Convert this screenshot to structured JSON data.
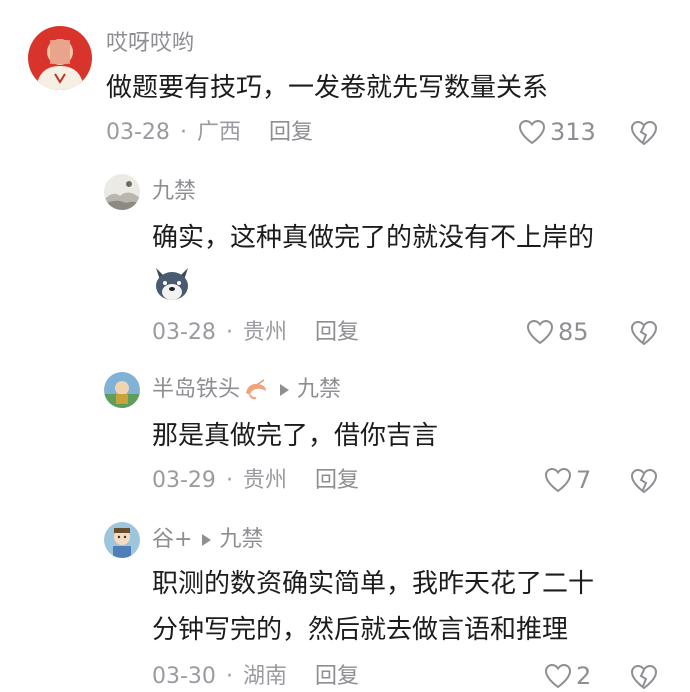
{
  "comments": [
    {
      "author": "哎呀哎哟",
      "text": [
        "做题要有技巧，一发卷就先写数量关系"
      ],
      "date": "03-28",
      "region": "广西",
      "reply_label": "回复",
      "likes": "313",
      "avatar_icon": "person-avatar"
    },
    {
      "author": "九禁",
      "text": [
        "确实，这种真做完了的就没有不上岸的"
      ],
      "date": "03-28",
      "region": "贵州",
      "reply_label": "回复",
      "likes": "85",
      "avatar_icon": "landscape-avatar",
      "sticker_icon": "dog-emoji-sticker"
    },
    {
      "author": "半岛铁头",
      "reply_to": "九禁",
      "text": [
        "那是真做完了，借你吉言"
      ],
      "date": "03-29",
      "region": "贵州",
      "reply_label": "回复",
      "likes": "7",
      "avatar_icon": "cartoon-avatar",
      "name_icon": "shrimp-icon"
    },
    {
      "author": "谷+",
      "reply_to": "九禁",
      "text": [
        "职测的数资确实简单，我昨天花了二十",
        "分钟写完的，然后就去做言语和推理"
      ],
      "date": "03-30",
      "region": "湖南",
      "reply_label": "回复",
      "likes": "2",
      "avatar_icon": "cartoon-avatar"
    }
  ],
  "separator": "·",
  "colors": {
    "text": "#1c1c1e",
    "meta": "#9a9aa0",
    "icon": "#8e8e93"
  }
}
